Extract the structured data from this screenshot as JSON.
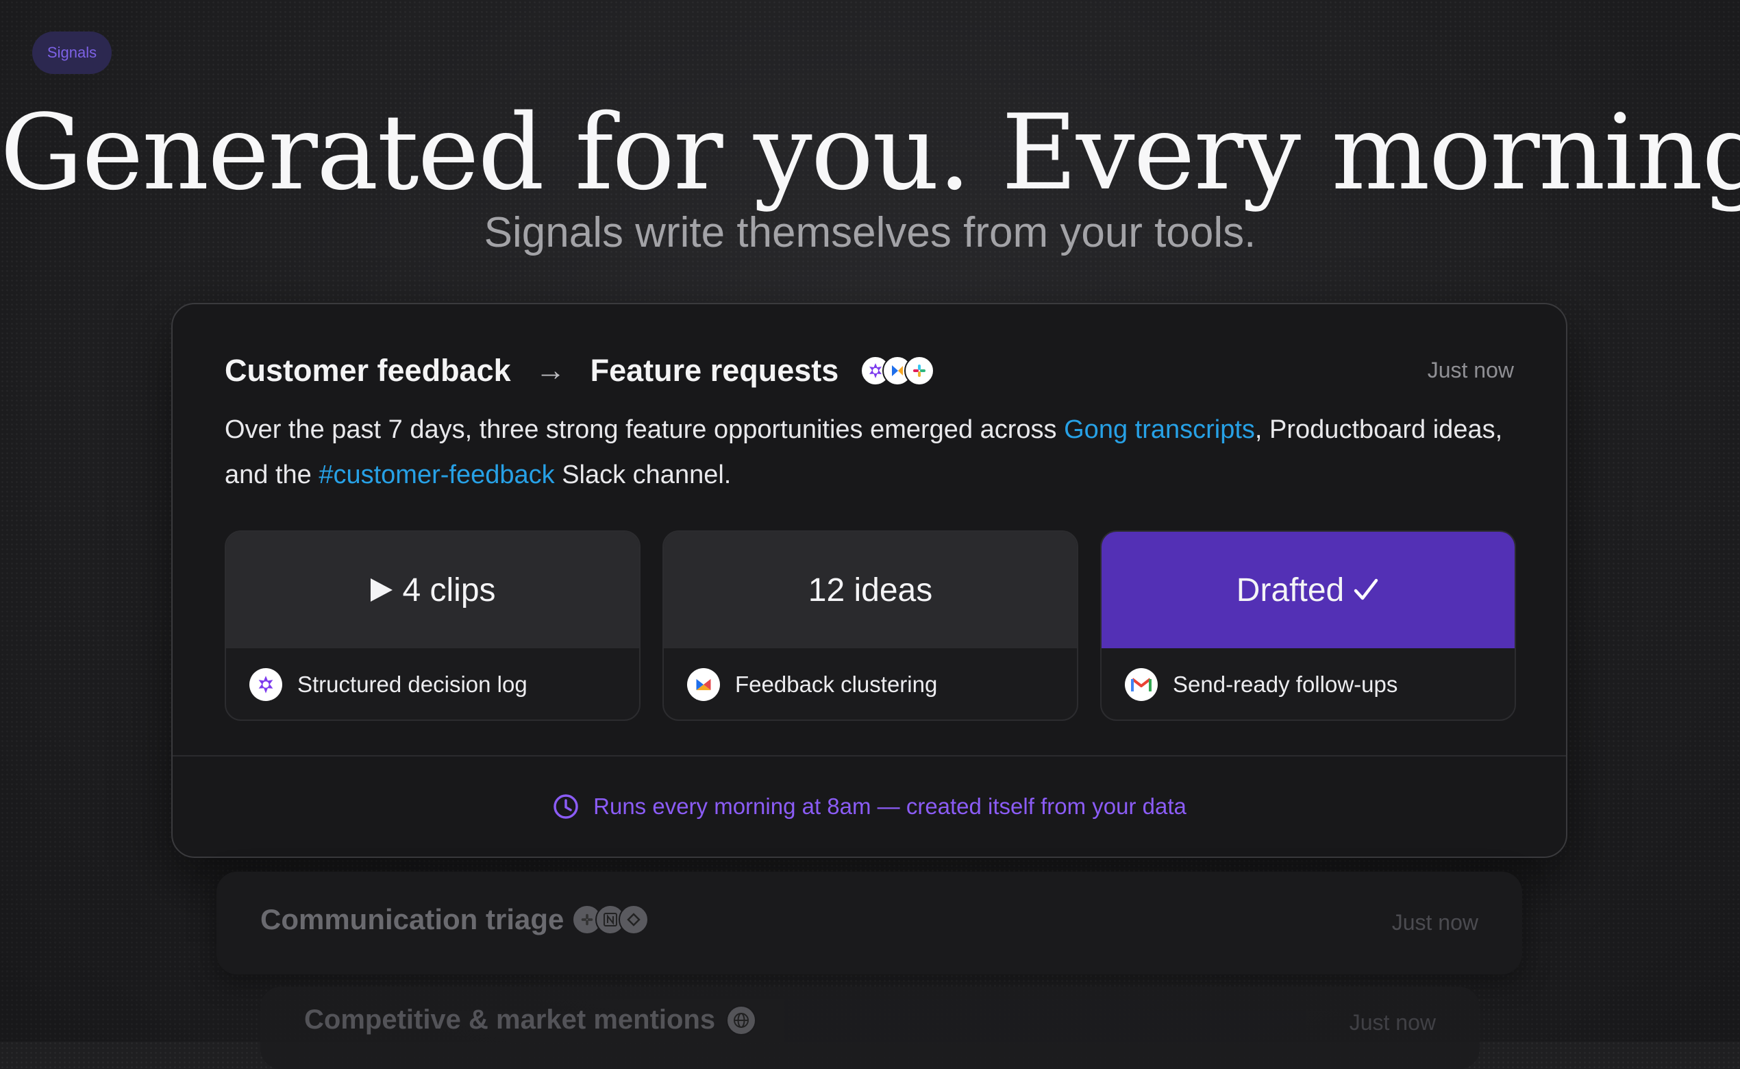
{
  "badge": "Signals",
  "hero": {
    "headline": "Generated for you. Every morning.",
    "subline": "Signals write themselves from your tools."
  },
  "card": {
    "source": "Customer feedback",
    "arrow": "→",
    "target": "Feature requests",
    "timestamp": "Just now",
    "summary": {
      "part1": "Over the past 7 days, three strong feature opportunities emerged across ",
      "link1": "Gong transcripts",
      "part2": ", Productboard ideas, and the ",
      "link2": "#customer-feedback",
      "part3": " Slack channel."
    },
    "tiles": [
      {
        "value": "4 clips",
        "icon": "play-icon",
        "label": "Structured decision log",
        "app_icon": "gong-icon"
      },
      {
        "value": "12 ideas",
        "label": "Feedback clustering",
        "app_icon": "productboard-icon"
      },
      {
        "value": "Drafted",
        "icon": "check-icon",
        "label": "Send-ready follow-ups",
        "app_icon": "gmail-icon"
      }
    ],
    "footer": "Runs every morning at 8am — created itself from your data"
  },
  "ghost_cards": [
    {
      "title": "Communication triage",
      "timestamp": "Just now"
    },
    {
      "title": "Competitive & market mentions",
      "timestamp": "Just now"
    }
  ],
  "colors": {
    "accent_purple": "#5330b5",
    "link_blue": "#27a1e6",
    "footer_purple": "#8b5cf6"
  }
}
